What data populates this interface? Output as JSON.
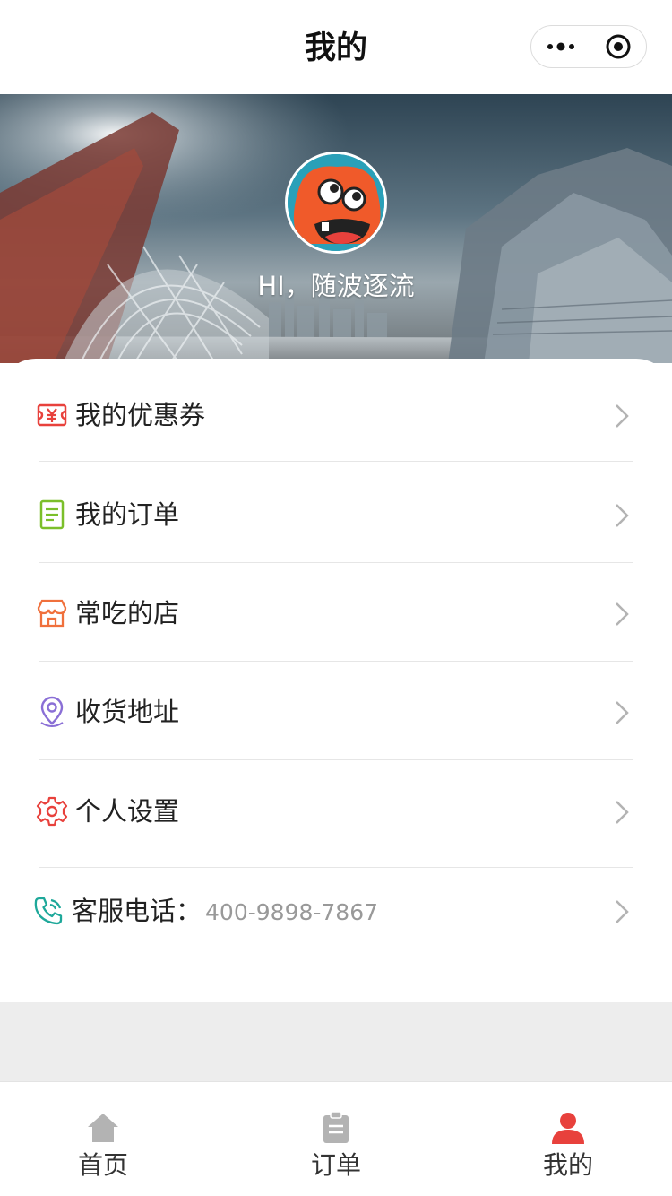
{
  "navbar": {
    "title": "我的",
    "more_icon": "more-dots-icon",
    "close_icon": "target-close-icon"
  },
  "profile": {
    "avatar_icon": "monster-avatar",
    "greeting": "HI，随波逐流"
  },
  "menu": [
    {
      "label": "我的优惠券",
      "icon": "coupon-icon",
      "color": "#e8413c"
    },
    {
      "label": "我的订单",
      "icon": "order-list-icon",
      "color": "#7bbf2a"
    },
    {
      "label": "常吃的店",
      "icon": "store-icon",
      "color": "#f0703c"
    },
    {
      "label": "收货地址",
      "icon": "location-pin-icon",
      "color": "#8a6fd6"
    },
    {
      "label": "个人设置",
      "icon": "gear-icon",
      "color": "#e8413c"
    }
  ],
  "service": {
    "label": "客服电话：",
    "phone": "400-9898-7867",
    "icon": "phone-icon",
    "color": "#1ea89a"
  },
  "tabbar": {
    "items": [
      {
        "label": "首页",
        "icon": "home-icon",
        "active": false
      },
      {
        "label": "订单",
        "icon": "clipboard-icon",
        "active": false
      },
      {
        "label": "我的",
        "icon": "user-icon",
        "active": true
      }
    ],
    "active_color": "#e8413c",
    "inactive_color": "#b3b3b3"
  }
}
